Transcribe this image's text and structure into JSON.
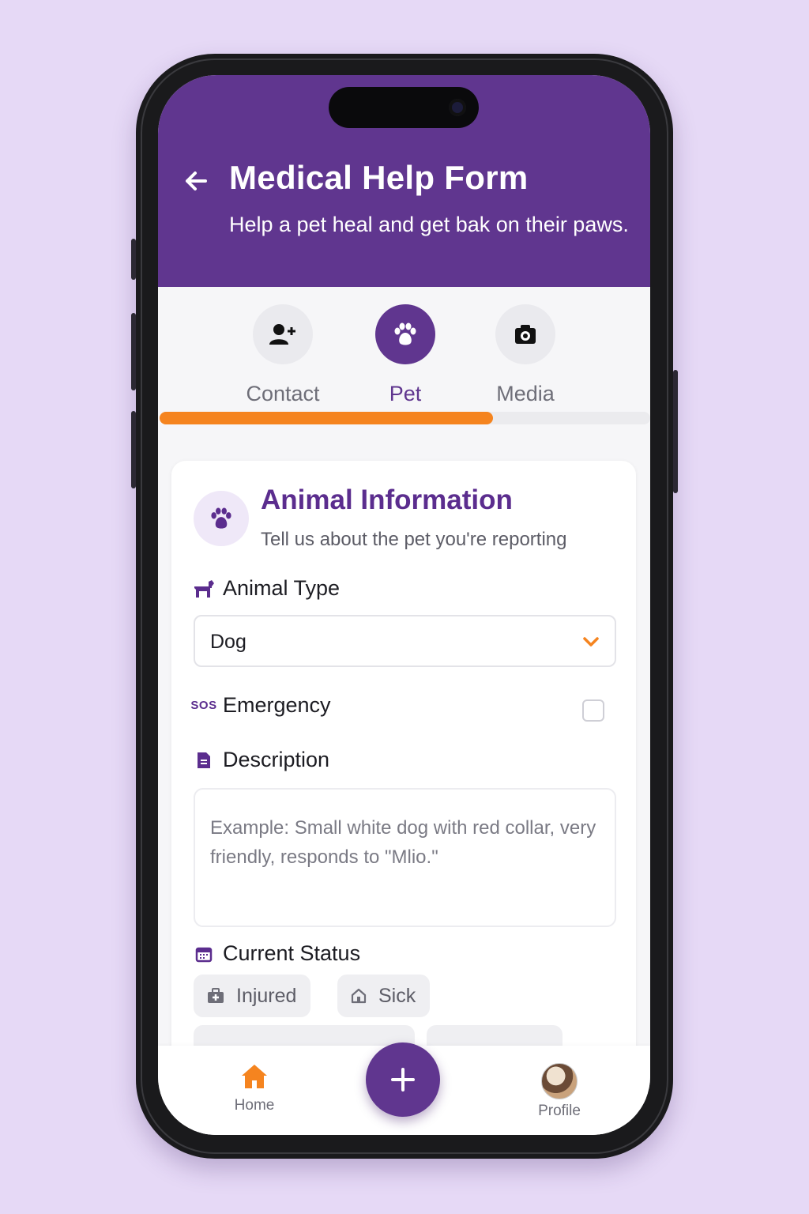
{
  "header": {
    "title": "Medical Help Form",
    "subtitle": "Help a pet heal and get bak on their paws."
  },
  "steps": [
    {
      "label": "Contact",
      "icon": "add-user-icon",
      "active": false
    },
    {
      "label": "Pet",
      "icon": "paw-icon",
      "active": true
    },
    {
      "label": "Media",
      "icon": "camera-icon",
      "active": false
    }
  ],
  "progress": {
    "fraction": 0.68,
    "color": "#f5841f"
  },
  "card": {
    "title": "Animal Information",
    "subtitle": "Tell us about the pet you're reporting",
    "animal_type": {
      "label": "Animal Type",
      "value": "Dog"
    },
    "emergency": {
      "label": "Emergency",
      "badge": "SOS",
      "checked": false
    },
    "description": {
      "label": "Description",
      "placeholder": "Example: Small white dog with red collar, very friendly, responds to \"Mlio.\""
    },
    "status": {
      "label": "Current Status",
      "options": [
        "Injured",
        "Sick"
      ]
    }
  },
  "bottom_nav": {
    "home_label": "Home",
    "profile_label": "Profile",
    "fab_symbol": "+"
  },
  "colors": {
    "primary": "#60368f",
    "accent": "#f5841f",
    "background": "#e6d9f6"
  }
}
